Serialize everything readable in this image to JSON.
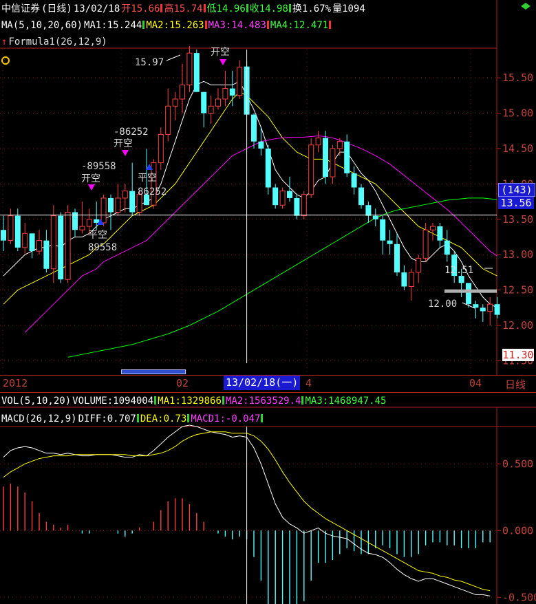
{
  "header": {
    "name": "中信证券",
    "period": "(日线)",
    "date": "13/02/18",
    "open_label": "开",
    "open": "15.66",
    "high_label": "高",
    "high": "15.74",
    "low_label": "低",
    "low": "14.96",
    "close_label": "收",
    "close": "14.98",
    "turnover_label": "换",
    "turnover": "1.67%",
    "volume_label": "量",
    "volume": "1094"
  },
  "ma_row": {
    "params": "MA(5,10,20,60)",
    "ma1": "MA1:15.244",
    "ma2": "MA2:15.263",
    "ma3": "MA3:14.483",
    "ma4": "MA4:12.471"
  },
  "formula_label": "Formula1(26,12,9)",
  "vol_row": {
    "params": "VOL(5,10,20)",
    "volume": "VOLUME:1094004",
    "ma1": "MA1:1329866",
    "ma2": "MA2:1563529.4",
    "ma3": "MA3:1468947.45"
  },
  "macd_row": {
    "params": "MACD(26,12,9)",
    "diff": "DIFF:0.707",
    "dea": "DEA:0.73",
    "macd": "MACD1:-0.047"
  },
  "time_axis": {
    "labels": [
      "2012",
      "02",
      "4",
      "04"
    ],
    "cursor_date": "13/02/18(一)",
    "period_button": "日线"
  },
  "price_panel": {
    "ytick_labels": [
      "15.50",
      "15.00",
      "14.50",
      "14.00",
      "13.50",
      "13.00",
      "12.50",
      "12.00",
      "11.50"
    ],
    "cursor_price_count": "(143)",
    "cursor_price": "13.56",
    "last_price": "11.30",
    "max_label": "15.97",
    "min_label": "12.00",
    "right_label": "12.51"
  },
  "annotations": [
    {
      "text": "开空",
      "color": "#ff00ff"
    },
    {
      "text": "-89558",
      "color": "#d8d8d8"
    },
    {
      "text": "平空",
      "color": "#0000ff"
    },
    {
      "text": "89558",
      "color": "#d8d8d8"
    },
    {
      "text": "-86252",
      "color": "#d8d8d8"
    },
    {
      "text": "开空",
      "color": "#ff00ff"
    },
    {
      "text": "平空",
      "color": "#0000ff"
    },
    {
      "text": "86252",
      "color": "#d8d8d8"
    },
    {
      "text": "开空",
      "color": "#ff00ff"
    }
  ],
  "macd_panel": {
    "ytick_labels": [
      "0.500",
      "0.000",
      "-0.500"
    ]
  },
  "colors": {
    "up": "#ff4040",
    "down": "#54ffff",
    "ma1": "#ffffff",
    "ma2": "#ffff00",
    "ma3": "#ff00ff",
    "ma4": "#00ff00",
    "axis": "#b02020",
    "header_red": "#ff5050",
    "header_green": "#40ff40"
  },
  "chart_data": [
    {
      "type": "candlestick",
      "title": "",
      "ylim": [
        11.3,
        15.9
      ],
      "candles": [
        {
          "o": 13.35,
          "h": 13.55,
          "l": 13.05,
          "c": 13.2
        },
        {
          "o": 13.2,
          "h": 13.65,
          "l": 13.15,
          "c": 13.55
        },
        {
          "o": 13.55,
          "h": 13.65,
          "l": 13.05,
          "c": 13.1
        },
        {
          "o": 13.1,
          "h": 13.45,
          "l": 13.0,
          "c": 13.3
        },
        {
          "o": 13.3,
          "h": 13.3,
          "l": 12.95,
          "c": 13.05
        },
        {
          "o": 13.05,
          "h": 13.35,
          "l": 13.0,
          "c": 13.2
        },
        {
          "o": 13.2,
          "h": 13.35,
          "l": 12.75,
          "c": 12.8
        },
        {
          "o": 12.8,
          "h": 13.7,
          "l": 12.6,
          "c": 13.55
        },
        {
          "o": 13.55,
          "h": 13.6,
          "l": 12.6,
          "c": 12.65
        },
        {
          "o": 12.65,
          "h": 13.7,
          "l": 12.6,
          "c": 13.6
        },
        {
          "o": 13.6,
          "h": 13.65,
          "l": 13.25,
          "c": 13.35
        },
        {
          "o": 13.35,
          "h": 13.75,
          "l": 13.3,
          "c": 13.4
        },
        {
          "o": 13.4,
          "h": 13.65,
          "l": 13.3,
          "c": 13.5
        },
        {
          "o": 13.5,
          "h": 13.75,
          "l": 13.35,
          "c": 13.45
        },
        {
          "o": 13.45,
          "h": 13.85,
          "l": 13.4,
          "c": 13.8
        },
        {
          "o": 13.8,
          "h": 13.85,
          "l": 13.35,
          "c": 13.6
        },
        {
          "o": 13.6,
          "h": 14.0,
          "l": 13.55,
          "c": 13.8
        },
        {
          "o": 13.8,
          "h": 14.0,
          "l": 13.6,
          "c": 13.9
        },
        {
          "o": 13.9,
          "h": 14.3,
          "l": 13.55,
          "c": 13.6
        },
        {
          "o": 13.6,
          "h": 13.9,
          "l": 13.55,
          "c": 13.85
        },
        {
          "o": 13.85,
          "h": 14.5,
          "l": 13.7,
          "c": 13.7
        },
        {
          "o": 13.7,
          "h": 14.35,
          "l": 13.65,
          "c": 14.3
        },
        {
          "o": 14.3,
          "h": 14.8,
          "l": 14.2,
          "c": 14.7
        },
        {
          "o": 14.7,
          "h": 15.35,
          "l": 14.6,
          "c": 15.1
        },
        {
          "o": 15.1,
          "h": 15.3,
          "l": 14.9,
          "c": 15.2
        },
        {
          "o": 15.2,
          "h": 15.7,
          "l": 15.0,
          "c": 15.4
        },
        {
          "o": 15.4,
          "h": 15.95,
          "l": 15.3,
          "c": 15.85
        },
        {
          "o": 15.85,
          "h": 15.9,
          "l": 15.3,
          "c": 15.3
        },
        {
          "o": 15.3,
          "h": 15.3,
          "l": 14.8,
          "c": 15.0
        },
        {
          "o": 15.0,
          "h": 15.25,
          "l": 14.85,
          "c": 15.1
        },
        {
          "o": 15.1,
          "h": 15.35,
          "l": 15.05,
          "c": 15.2
        },
        {
          "o": 15.2,
          "h": 15.6,
          "l": 15.1,
          "c": 15.35
        },
        {
          "o": 15.35,
          "h": 15.6,
          "l": 15.1,
          "c": 15.25
        },
        {
          "o": 15.25,
          "h": 15.75,
          "l": 15.2,
          "c": 15.65
        },
        {
          "o": 15.66,
          "h": 15.74,
          "l": 14.96,
          "c": 14.98
        },
        {
          "o": 14.98,
          "h": 15.0,
          "l": 14.5,
          "c": 14.6
        },
        {
          "o": 14.6,
          "h": 14.8,
          "l": 14.4,
          "c": 14.5
        },
        {
          "o": 14.5,
          "h": 14.55,
          "l": 13.85,
          "c": 13.95
        },
        {
          "o": 13.95,
          "h": 14.0,
          "l": 13.65,
          "c": 13.7
        },
        {
          "o": 13.7,
          "h": 13.95,
          "l": 13.65,
          "c": 13.9
        },
        {
          "o": 13.9,
          "h": 14.1,
          "l": 13.75,
          "c": 13.8
        },
        {
          "o": 13.8,
          "h": 13.85,
          "l": 13.5,
          "c": 13.55
        },
        {
          "o": 13.55,
          "h": 13.9,
          "l": 13.5,
          "c": 13.85
        },
        {
          "o": 13.85,
          "h": 14.65,
          "l": 13.8,
          "c": 14.55
        },
        {
          "o": 14.55,
          "h": 14.75,
          "l": 14.45,
          "c": 14.65
        },
        {
          "o": 14.65,
          "h": 14.75,
          "l": 14.0,
          "c": 14.1
        },
        {
          "o": 14.1,
          "h": 14.55,
          "l": 14.0,
          "c": 14.5
        },
        {
          "o": 14.5,
          "h": 14.65,
          "l": 14.4,
          "c": 14.6
        },
        {
          "o": 14.6,
          "h": 14.7,
          "l": 14.1,
          "c": 14.15
        },
        {
          "o": 14.15,
          "h": 14.25,
          "l": 13.85,
          "c": 13.95
        },
        {
          "o": 13.95,
          "h": 14.0,
          "l": 13.65,
          "c": 13.7
        },
        {
          "o": 13.7,
          "h": 13.75,
          "l": 13.45,
          "c": 13.55
        },
        {
          "o": 13.55,
          "h": 13.65,
          "l": 13.4,
          "c": 13.5
        },
        {
          "o": 13.5,
          "h": 13.55,
          "l": 13.0,
          "c": 13.2
        },
        {
          "o": 13.2,
          "h": 13.35,
          "l": 13.0,
          "c": 13.15
        },
        {
          "o": 13.15,
          "h": 13.3,
          "l": 12.7,
          "c": 12.75
        },
        {
          "o": 12.75,
          "h": 12.85,
          "l": 12.5,
          "c": 12.55
        },
        {
          "o": 12.55,
          "h": 12.8,
          "l": 12.35,
          "c": 12.75
        },
        {
          "o": 12.75,
          "h": 13.0,
          "l": 12.6,
          "c": 12.95
        },
        {
          "o": 12.95,
          "h": 13.45,
          "l": 12.9,
          "c": 13.35
        },
        {
          "o": 13.35,
          "h": 13.45,
          "l": 13.2,
          "c": 13.4
        },
        {
          "o": 13.4,
          "h": 13.45,
          "l": 13.1,
          "c": 13.2
        },
        {
          "o": 13.2,
          "h": 13.35,
          "l": 12.9,
          "c": 13.0
        },
        {
          "o": 13.0,
          "h": 13.05,
          "l": 12.6,
          "c": 12.7
        },
        {
          "o": 12.7,
          "h": 12.8,
          "l": 12.4,
          "c": 12.6
        },
        {
          "o": 12.6,
          "h": 12.5,
          "l": 12.25,
          "c": 12.3
        },
        {
          "o": 12.3,
          "h": 12.35,
          "l": 12.1,
          "c": 12.25
        },
        {
          "o": 12.25,
          "h": 12.3,
          "l": 12.05,
          "c": 12.2
        },
        {
          "o": 12.2,
          "h": 12.4,
          "l": 12.0,
          "c": 12.3
        },
        {
          "o": 12.3,
          "h": 12.4,
          "l": 12.1,
          "c": 12.15
        }
      ],
      "series": [
        {
          "name": "MA1",
          "values": [
            12.7,
            12.8,
            12.9,
            13.0,
            13.05,
            13.1,
            13.1,
            13.15,
            13.1,
            13.2,
            13.25,
            13.25,
            13.3,
            13.4,
            13.5,
            13.55,
            13.6,
            13.65,
            13.65,
            13.7,
            13.75,
            13.8,
            14.0,
            14.3,
            14.6,
            14.9,
            15.2,
            15.4,
            15.45,
            15.4,
            15.4,
            15.4,
            15.4,
            15.45,
            15.25,
            15.05,
            14.8,
            14.5,
            14.2,
            14.05,
            13.95,
            13.85,
            13.8,
            13.9,
            14.05,
            14.1,
            14.3,
            14.45,
            14.45,
            14.3,
            14.15,
            14.05,
            13.9,
            13.7,
            13.5,
            13.3,
            13.1,
            12.95,
            12.9,
            12.9,
            13.0,
            13.1,
            13.15,
            13.05,
            12.9,
            12.7,
            12.55,
            12.4,
            12.3,
            12.25
          ]
        },
        {
          "name": "MA2",
          "values": [
            12.3,
            12.4,
            12.5,
            12.55,
            12.6,
            12.65,
            12.7,
            12.75,
            12.8,
            12.85,
            12.9,
            12.95,
            13.0,
            13.1,
            13.15,
            13.25,
            13.35,
            13.45,
            13.55,
            13.6,
            13.65,
            13.7,
            13.8,
            13.9,
            14.0,
            14.15,
            14.3,
            14.45,
            14.6,
            14.75,
            14.9,
            15.05,
            15.2,
            15.3,
            15.25,
            15.15,
            15.05,
            14.95,
            14.8,
            14.65,
            14.55,
            14.45,
            14.4,
            14.35,
            14.35,
            14.35,
            14.3,
            14.25,
            14.2,
            14.15,
            14.1,
            14.05,
            14.0,
            13.9,
            13.8,
            13.7,
            13.6,
            13.5,
            13.4,
            13.35,
            13.3,
            13.25,
            13.2,
            13.15,
            13.1,
            13.0,
            12.9,
            12.8,
            12.75,
            12.7
          ]
        },
        {
          "name": "MA3",
          "values": [
            11.9,
            12.0,
            12.1,
            12.2,
            12.3,
            12.4,
            12.5,
            12.6,
            12.7,
            12.75,
            12.8,
            12.9,
            12.95,
            13.0,
            13.05,
            13.1,
            13.15,
            13.2,
            13.3,
            13.4,
            13.5,
            13.6,
            13.7,
            13.8,
            13.9,
            14.0,
            14.1,
            14.2,
            14.3,
            14.4,
            14.45,
            14.5,
            14.55,
            14.6,
            14.62,
            14.64,
            14.65,
            14.66,
            14.66,
            14.66,
            14.67,
            14.68,
            14.67,
            14.65,
            14.62,
            14.58,
            14.54,
            14.5,
            14.45,
            14.4,
            14.34,
            14.28,
            14.2,
            14.12,
            14.04,
            13.96,
            13.88,
            13.8,
            13.72,
            13.64,
            13.55,
            13.45,
            13.35,
            13.25,
            13.15,
            13.05,
            12.98
          ]
        },
        {
          "name": "MA4",
          "values": [
            11.55,
            11.57,
            11.59,
            11.61,
            11.63,
            11.65,
            11.67,
            11.69,
            11.71,
            11.73,
            11.76,
            11.79,
            11.82,
            11.85,
            11.88,
            11.92,
            11.96,
            12.0,
            12.05,
            12.1,
            12.15,
            12.2,
            12.26,
            12.32,
            12.38,
            12.44,
            12.5,
            12.56,
            12.62,
            12.68,
            12.74,
            12.8,
            12.86,
            12.92,
            12.98,
            13.04,
            13.1,
            13.16,
            13.22,
            13.28,
            13.34,
            13.4,
            13.46,
            13.52,
            13.56,
            13.6,
            13.63,
            13.65,
            13.67,
            13.69,
            13.71,
            13.73,
            13.75,
            13.77,
            13.78,
            13.79,
            13.8,
            13.8,
            13.8,
            13.79,
            13.78
          ]
        }
      ]
    },
    {
      "type": "bar",
      "title": "MACD",
      "ylim": [
        -0.55,
        0.78
      ],
      "series": [
        {
          "name": "DIFF",
          "values": [
            0.55,
            0.6,
            0.62,
            0.63,
            0.62,
            0.6,
            0.58,
            0.58,
            0.57,
            0.58,
            0.57,
            0.56,
            0.56,
            0.57,
            0.57,
            0.57,
            0.56,
            0.55,
            0.55,
            0.57,
            0.56,
            0.6,
            0.65,
            0.7,
            0.74,
            0.78,
            0.79,
            0.78,
            0.76,
            0.74,
            0.73,
            0.72,
            0.7,
            0.71,
            0.7,
            0.62,
            0.5,
            0.35,
            0.2,
            0.1,
            0.05,
            0.02,
            -0.02,
            0.0,
            0.02,
            -0.02,
            -0.04,
            -0.05,
            -0.06,
            -0.1,
            -0.14,
            -0.17,
            -0.18,
            -0.2,
            -0.24,
            -0.29,
            -0.33,
            -0.36,
            -0.38,
            -0.36,
            -0.36,
            -0.38,
            -0.4,
            -0.42,
            -0.44,
            -0.46,
            -0.48,
            -0.48,
            -0.49
          ]
        },
        {
          "name": "DEA",
          "values": [
            0.4,
            0.44,
            0.47,
            0.5,
            0.52,
            0.54,
            0.55,
            0.56,
            0.56,
            0.56,
            0.57,
            0.57,
            0.57,
            0.57,
            0.57,
            0.57,
            0.57,
            0.57,
            0.56,
            0.56,
            0.56,
            0.57,
            0.58,
            0.6,
            0.63,
            0.67,
            0.7,
            0.72,
            0.73,
            0.74,
            0.74,
            0.74,
            0.73,
            0.73,
            0.73,
            0.71,
            0.67,
            0.61,
            0.53,
            0.44,
            0.36,
            0.29,
            0.22,
            0.17,
            0.13,
            0.09,
            0.06,
            0.03,
            0.0,
            -0.03,
            -0.06,
            -0.09,
            -0.12,
            -0.15,
            -0.18,
            -0.21,
            -0.24,
            -0.27,
            -0.3,
            -0.31,
            -0.32,
            -0.34,
            -0.35,
            -0.37,
            -0.38,
            -0.4,
            -0.42,
            -0.44,
            -0.45
          ]
        },
        {
          "name": "MACD1",
          "values": [
            0.15,
            0.16,
            0.15,
            0.13,
            0.1,
            0.06,
            0.03,
            0.02,
            0.01,
            0.02,
            0.0,
            -0.01,
            -0.01,
            0.0,
            0.0,
            0.0,
            -0.01,
            -0.02,
            -0.01,
            0.01,
            0.0,
            0.03,
            0.07,
            0.1,
            0.11,
            0.11,
            0.09,
            0.06,
            0.03,
            0.0,
            -0.01,
            -0.02,
            -0.03,
            -0.02,
            -0.03,
            -0.09,
            -0.17,
            -0.26,
            -0.33,
            -0.34,
            -0.31,
            -0.27,
            -0.24,
            -0.17,
            -0.11,
            -0.11,
            -0.1,
            -0.08,
            -0.06,
            -0.07,
            -0.08,
            -0.08,
            -0.06,
            -0.05,
            -0.06,
            -0.08,
            -0.09,
            -0.09,
            -0.08,
            -0.05,
            -0.04,
            -0.04,
            -0.05,
            -0.05,
            -0.06,
            -0.06,
            -0.06,
            -0.04,
            -0.04
          ]
        }
      ]
    }
  ]
}
